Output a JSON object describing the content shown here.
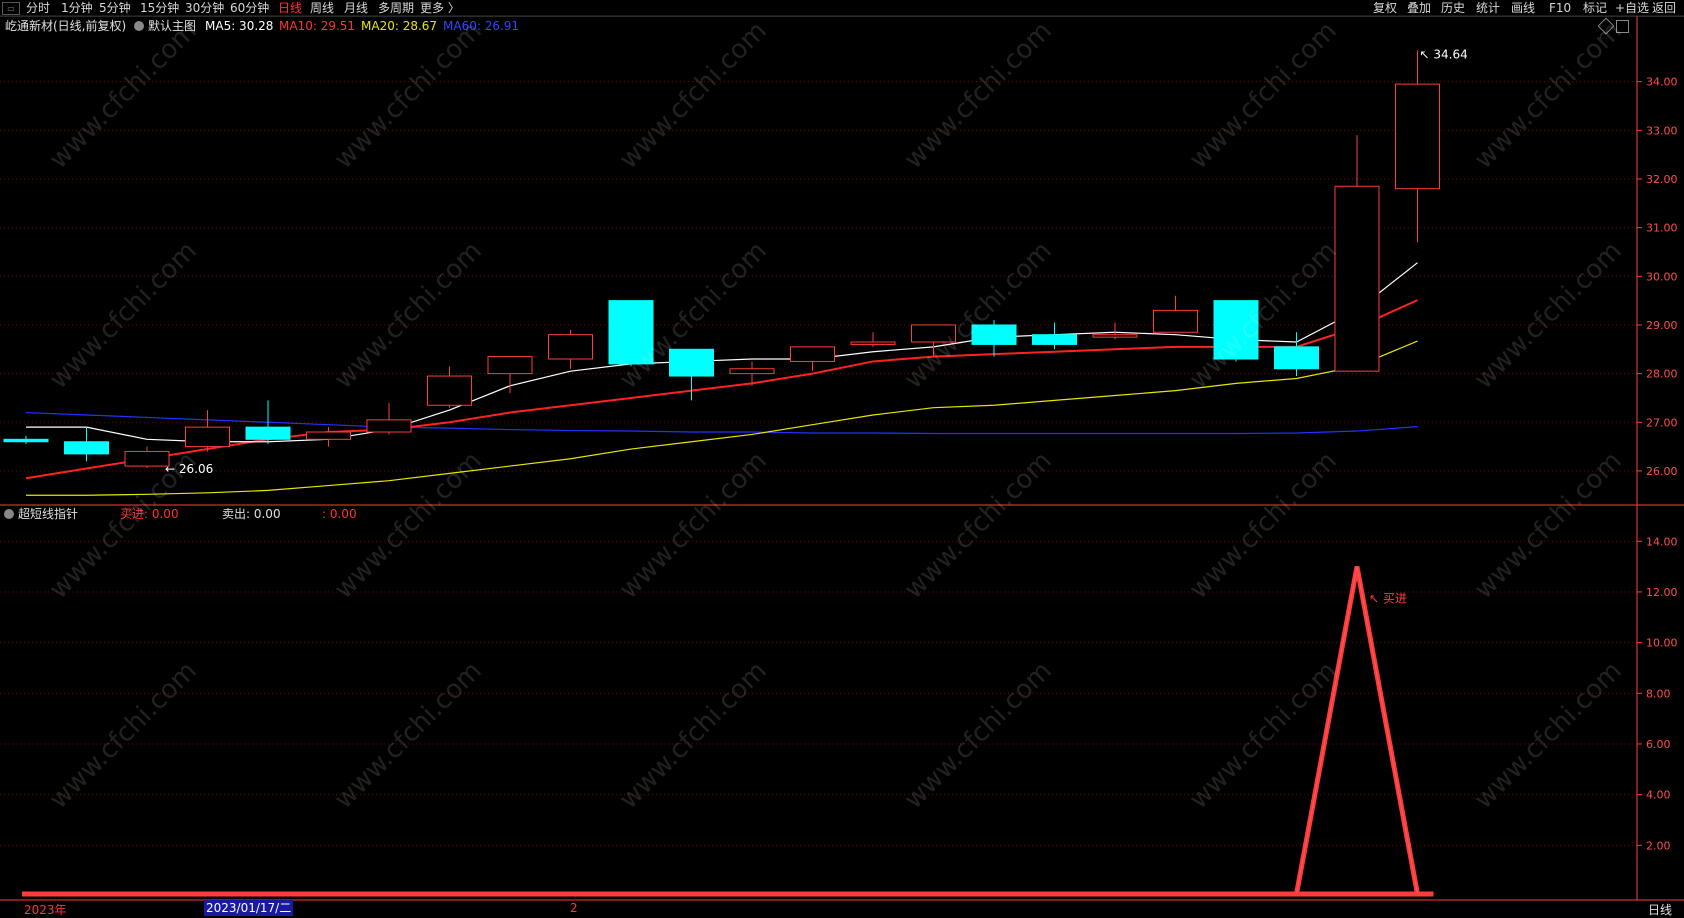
{
  "toolbar": {
    "tabs": [
      {
        "label": "分时",
        "active": false
      },
      {
        "label": "1分钟",
        "active": false
      },
      {
        "label": "5分钟",
        "active": false
      },
      {
        "label": "15分钟",
        "active": false
      },
      {
        "label": "30分钟",
        "active": false
      },
      {
        "label": "60分钟",
        "active": false
      },
      {
        "label": "日线",
        "active": true
      },
      {
        "label": "周线",
        "active": false
      },
      {
        "label": "月线",
        "active": false
      },
      {
        "label": "多周期",
        "active": false
      },
      {
        "label": "更多 〉",
        "active": false
      }
    ],
    "right_buttons": [
      "复权",
      "叠加",
      "历史",
      "统计",
      "画线",
      "F10",
      "标记",
      "+自选",
      "返回"
    ]
  },
  "main_legend": {
    "stock": "屹通新材(日线,前复权)",
    "template": "默认主图",
    "ma5": "MA5: 30.28",
    "ma10": "MA10: 29.51",
    "ma20": "MA20: 28.67",
    "ma60": "MA60: 26.91"
  },
  "sub_legend": {
    "name": "超短线指针",
    "buy": "买进: 0.00",
    "sell": "卖出: 0.00",
    "third": ": 0.00"
  },
  "bottom": {
    "year": "2023年",
    "date": "2023/01/17/二",
    "marker": "2",
    "period": "日线"
  },
  "watermark_text": "www.cfchi.com",
  "colors": {
    "up": "#ff3b3b",
    "down": "#00ffff",
    "ma5": "#ffffff",
    "ma10": "#ff2222",
    "ma20": "#e6e600",
    "ma60": "#2233ff",
    "axis": "#ff3b3b"
  },
  "chart_data": [
    {
      "type": "candlestick",
      "title": "屹通新材(日线,前复权)",
      "ylim": [
        25.3,
        35.0
      ],
      "yticks": [
        26.0,
        27.0,
        28.0,
        29.0,
        30.0,
        31.0,
        32.0,
        33.0,
        34.0
      ],
      "candles": [
        {
          "o": 26.65,
          "c": 26.6,
          "h": 26.72,
          "l": 26.55
        },
        {
          "o": 26.6,
          "c": 26.35,
          "h": 26.9,
          "l": 26.2
        },
        {
          "o": 26.1,
          "c": 26.4,
          "h": 26.5,
          "l": 26.06
        },
        {
          "o": 26.5,
          "c": 26.9,
          "h": 27.25,
          "l": 26.4
        },
        {
          "o": 26.9,
          "c": 26.65,
          "h": 27.45,
          "l": 26.55
        },
        {
          "o": 26.65,
          "c": 26.8,
          "h": 26.9,
          "l": 26.5
        },
        {
          "o": 26.8,
          "c": 27.05,
          "h": 27.4,
          "l": 26.75
        },
        {
          "o": 27.35,
          "c": 27.95,
          "h": 28.15,
          "l": 27.3
        },
        {
          "o": 28.0,
          "c": 28.35,
          "h": 28.35,
          "l": 27.6
        },
        {
          "o": 28.3,
          "c": 28.8,
          "h": 28.9,
          "l": 28.1
        },
        {
          "o": 29.5,
          "c": 28.2,
          "h": 29.5,
          "l": 28.15
        },
        {
          "o": 28.5,
          "c": 27.95,
          "h": 28.5,
          "l": 27.45
        },
        {
          "o": 28.0,
          "c": 28.1,
          "h": 28.25,
          "l": 27.75
        },
        {
          "o": 28.25,
          "c": 28.55,
          "h": 28.55,
          "l": 28.05
        },
        {
          "o": 28.6,
          "c": 28.65,
          "h": 28.85,
          "l": 28.55
        },
        {
          "o": 28.65,
          "c": 29.0,
          "h": 29.0,
          "l": 28.35
        },
        {
          "o": 29.0,
          "c": 28.6,
          "h": 29.1,
          "l": 28.35
        },
        {
          "o": 28.8,
          "c": 28.6,
          "h": 29.05,
          "l": 28.5
        },
        {
          "o": 28.75,
          "c": 28.8,
          "h": 29.05,
          "l": 28.7
        },
        {
          "o": 28.85,
          "c": 29.3,
          "h": 29.6,
          "l": 28.85
        },
        {
          "o": 29.5,
          "c": 28.3,
          "h": 29.5,
          "l": 28.25
        },
        {
          "o": 28.55,
          "c": 28.1,
          "h": 28.85,
          "l": 27.95
        },
        {
          "o": 28.05,
          "c": 31.85,
          "h": 32.9,
          "l": 28.05
        },
        {
          "o": 31.8,
          "c": 33.95,
          "h": 34.64,
          "l": 30.7
        }
      ],
      "ma5": [
        26.9,
        26.9,
        26.65,
        26.6,
        26.6,
        26.65,
        26.85,
        27.25,
        27.75,
        28.05,
        28.2,
        28.25,
        28.3,
        28.3,
        28.45,
        28.55,
        28.75,
        28.8,
        28.85,
        28.8,
        28.7,
        28.65,
        29.3,
        30.28
      ],
      "ma10": [
        25.85,
        26.05,
        26.25,
        26.45,
        26.65,
        26.8,
        26.85,
        27.0,
        27.2,
        27.35,
        27.5,
        27.65,
        27.8,
        28.0,
        28.25,
        28.35,
        28.4,
        28.45,
        28.5,
        28.55,
        28.55,
        28.55,
        28.95,
        29.51
      ],
      "ma20": [
        25.5,
        25.5,
        25.52,
        25.55,
        25.6,
        25.7,
        25.8,
        25.95,
        26.1,
        26.25,
        26.45,
        26.6,
        26.75,
        26.95,
        27.15,
        27.3,
        27.35,
        27.45,
        27.55,
        27.65,
        27.8,
        27.9,
        28.15,
        28.67
      ],
      "ma60": [
        27.2,
        27.15,
        27.1,
        27.05,
        27.0,
        26.95,
        26.9,
        26.88,
        26.85,
        26.83,
        26.82,
        26.8,
        26.8,
        26.78,
        26.78,
        26.77,
        26.77,
        26.77,
        26.77,
        26.77,
        26.77,
        26.78,
        26.82,
        26.91
      ],
      "annotations": {
        "high": "34.64",
        "low": "26.06"
      }
    },
    {
      "type": "line",
      "title": "超短线指针",
      "ylim": [
        0.0,
        14.8
      ],
      "yticks": [
        2.0,
        4.0,
        6.0,
        8.0,
        10.0,
        12.0,
        14.0
      ],
      "series": [
        {
          "name": "买进",
          "values": [
            0,
            0,
            0,
            0,
            0,
            0,
            0,
            0,
            0,
            0,
            0,
            0,
            0,
            0,
            0,
            0,
            0,
            0,
            0,
            0,
            0,
            0,
            13.0,
            0
          ]
        }
      ],
      "annotation_label": "买进"
    }
  ]
}
